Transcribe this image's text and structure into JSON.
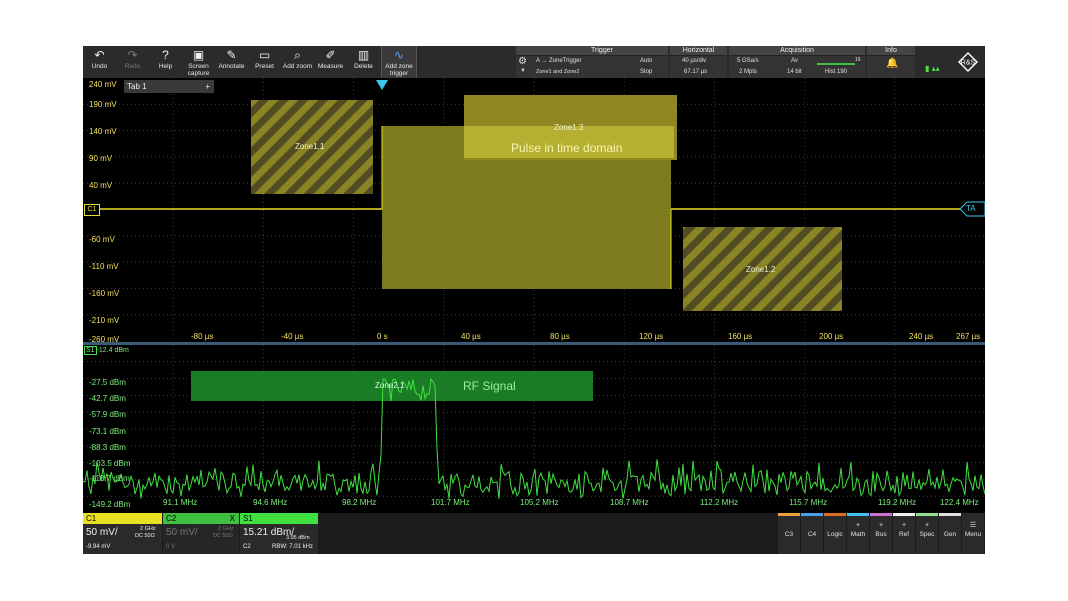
{
  "toolbar": {
    "buttons": [
      {
        "icon": "↶",
        "label": "Undo"
      },
      {
        "icon": "↷",
        "label": "Redo"
      },
      {
        "icon": "?",
        "label": "Help"
      },
      {
        "icon": "▣",
        "label": "Screen capture"
      },
      {
        "icon": "✎",
        "label": "Annotate"
      },
      {
        "icon": "▭",
        "label": "Preset"
      },
      {
        "icon": "⌕",
        "label": "Add zoom"
      },
      {
        "icon": "✐",
        "label": "Measure"
      },
      {
        "icon": "▥",
        "label": "Delete"
      },
      {
        "icon": "∿",
        "label": "Add zone trigger"
      }
    ],
    "trigger": {
      "title": "Trigger",
      "source": "A → ZoneTrigger",
      "condition": "Zone1 and Zone2",
      "mode": "Auto",
      "state": "Stop"
    },
    "horizontal": {
      "title": "Horizontal",
      "scale": "40 µs/div",
      "position": "67.17 µs"
    },
    "acquisition": {
      "title": "Acquisition",
      "rate": "5 GSa/s",
      "points": "2 Mpts",
      "mode": "Av",
      "bits": "14 bit",
      "count": "16",
      "hist": "Hist 190"
    },
    "info": {
      "title": "Info"
    }
  },
  "tab": {
    "label": "Tab 1",
    "add": "+"
  },
  "diagram1": {
    "y_labels": [
      "240 mV",
      "190 mV",
      "140 mV",
      "90 mV",
      "40 mV",
      "C1",
      "-60 mV",
      "-110 mV",
      "-160 mV",
      "-210 mV",
      "-260 mV"
    ],
    "x_labels": [
      "-80 µs",
      "-40 µs",
      "0 s",
      "40 µs",
      "80 µs",
      "120 µs",
      "160 µs",
      "200 µs",
      "240 µs",
      "267 µs"
    ],
    "zones": [
      "Zone1.1",
      "Zone1.3",
      "Zone1.2"
    ],
    "annotation": "Pulse in time domain",
    "trigger_marker": "TA"
  },
  "diagram2": {
    "y_labels": [
      "-12.4 dBm",
      "-27.5 dBm",
      "-42.7 dBm",
      "-57.9 dBm",
      "-73.1 dBm",
      "-88.3 dBm",
      "-103.5 dBm",
      "-118.7 dBm",
      "-149.2 dBm"
    ],
    "x_labels": [
      "91.1 MHz",
      "94.6 MHz",
      "98.2 MHz",
      "101.7 MHz",
      "105.2 MHz",
      "108.7 MHz",
      "112.2 MHz",
      "115.7 MHz",
      "119.2 MHz",
      "122.4 MHz"
    ],
    "zone": "Zone2.1",
    "annotation": "RF Signal",
    "signal_label": "S1"
  },
  "channels": {
    "c1": {
      "name": "C1",
      "scale": "50 mV/",
      "bw": "2 GHz",
      "coupling": "DC 50Ω",
      "offset": "-9.94 mV"
    },
    "c2": {
      "name": "C2",
      "close": "X",
      "scale": "50 mV/",
      "bw": "2 GHz",
      "coupling": "DC 50Ω",
      "offset": "0 V"
    },
    "s1": {
      "name": "S1",
      "scale": "15.21 dBm/",
      "span": "3.95 dBm",
      "source": "C2",
      "rbw": "RBW: 7.01 kHz"
    }
  },
  "right_buttons": [
    {
      "label": "C3",
      "color": "#f0a040"
    },
    {
      "label": "C4",
      "color": "#4aa0f0"
    },
    {
      "label": "Logic",
      "color": "#e07020"
    },
    {
      "label": "Math",
      "color": "#40c0f0"
    },
    {
      "label": "Bus",
      "color": "#d070d0"
    },
    {
      "label": "Ref",
      "color": "#f0f0f0"
    },
    {
      "label": "Spec",
      "color": "#90e090"
    },
    {
      "label": "Gen",
      "color": "#e0e0e0"
    },
    {
      "label": "Menu",
      "color": "#2a2a2a"
    }
  ],
  "colors": {
    "c1": "#e8e020",
    "c2": "#40e040",
    "s1": "#40e040",
    "zone": "#c8c030",
    "divider": "#3b5a78"
  }
}
